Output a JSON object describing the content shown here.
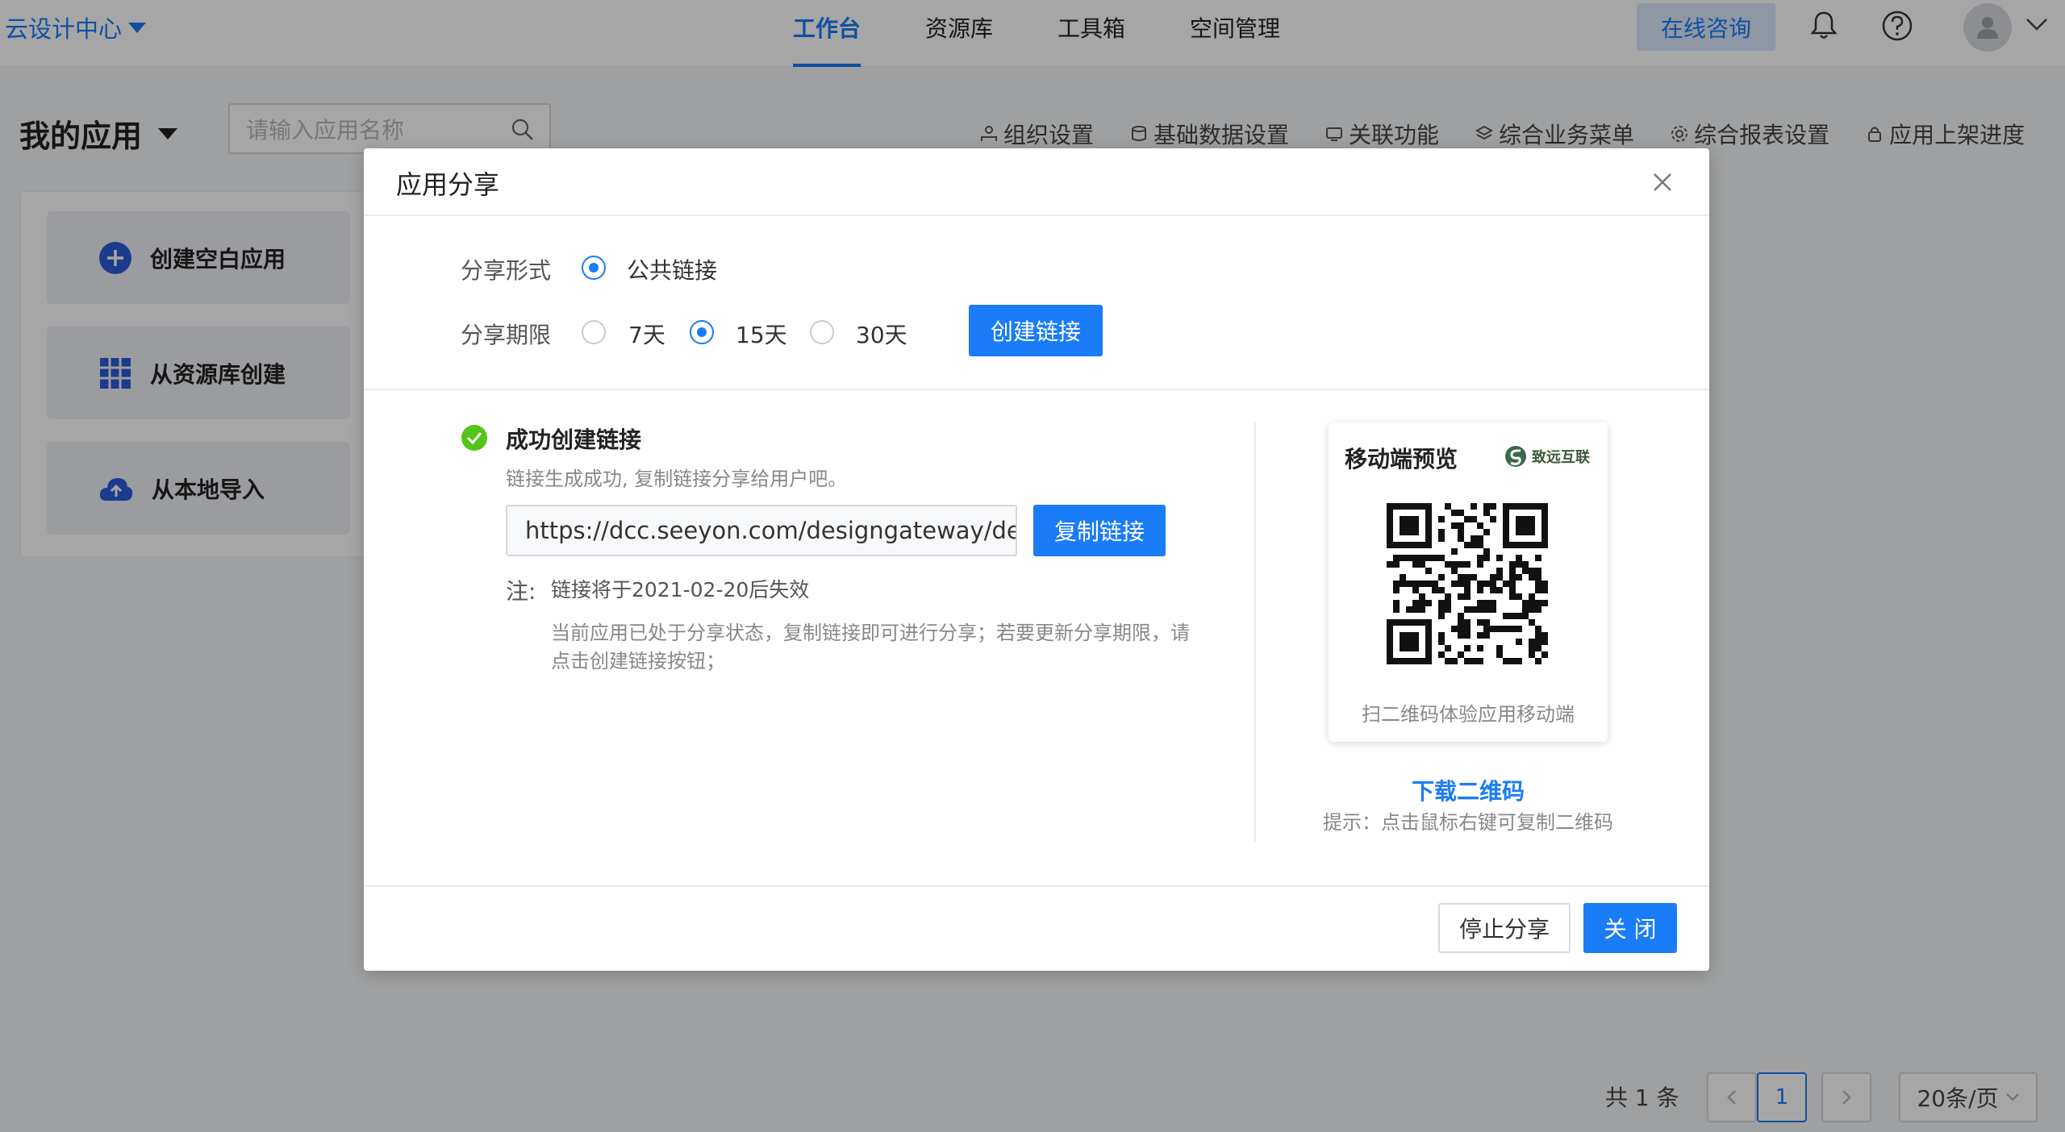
{
  "header": {
    "brand": "云设计中心",
    "nav": [
      {
        "label": "工作台",
        "active": true
      },
      {
        "label": "资源库",
        "active": false
      },
      {
        "label": "工具箱",
        "active": false
      },
      {
        "label": "空间管理",
        "active": false
      }
    ],
    "consult_label": "在线咨询",
    "icons": [
      "bell-icon",
      "help-icon",
      "user-avatar-icon",
      "chevron-down-icon"
    ]
  },
  "page": {
    "title": "我的应用",
    "search_placeholder": "请输入应用名称",
    "tools": [
      {
        "label": "组织设置",
        "icon": "org-icon"
      },
      {
        "label": "基础数据设置",
        "icon": "database-icon"
      },
      {
        "label": "关联功能",
        "icon": "link-icon"
      },
      {
        "label": "综合业务菜单",
        "icon": "layers-icon"
      },
      {
        "label": "综合报表设置",
        "icon": "gear-icon"
      },
      {
        "label": "应用上架进度",
        "icon": "lock-icon"
      }
    ],
    "create_cards": [
      {
        "label": "创建空白应用",
        "icon": "plus-circle-icon"
      },
      {
        "label": "从资源库创建",
        "icon": "grid-icon"
      },
      {
        "label": "从本地导入",
        "icon": "cloud-upload-icon"
      }
    ]
  },
  "pagination": {
    "total": "共 1 条",
    "current_page": "1",
    "page_size": "20条/页"
  },
  "modal": {
    "title": "应用分享",
    "share_form_label": "分享形式",
    "share_form_option": "公共链接",
    "share_period_label": "分享期限",
    "periods": [
      {
        "label": "7天",
        "checked": false
      },
      {
        "label": "15天",
        "checked": true
      },
      {
        "label": "30天",
        "checked": false
      }
    ],
    "create_link_label": "创建链接",
    "success_title": "成功创建链接",
    "success_sub": "链接生成成功, 复制链接分享给用户吧。",
    "link_value": "https://dcc.seeyon.com/designgateway/des",
    "copy_link_label": "复制链接",
    "note_label": "注:",
    "note_expiry": "链接将于2021-02-20后失效",
    "note_detail": "当前应用已处于分享状态，复制链接即可进行分享；若要更新分享期限，请点击创建链接按钮；",
    "qr": {
      "title": "移动端预览",
      "logo_text": "致远互联",
      "caption": "扫二维码体验应用移动端",
      "download_label": "下载二维码",
      "tip": "提示：点击鼠标右键可复制二维码"
    },
    "stop_share_label": "停止分享",
    "close_label": "关 闭"
  },
  "colors": {
    "accent": "#1a7cf7",
    "success": "#52c41a"
  }
}
